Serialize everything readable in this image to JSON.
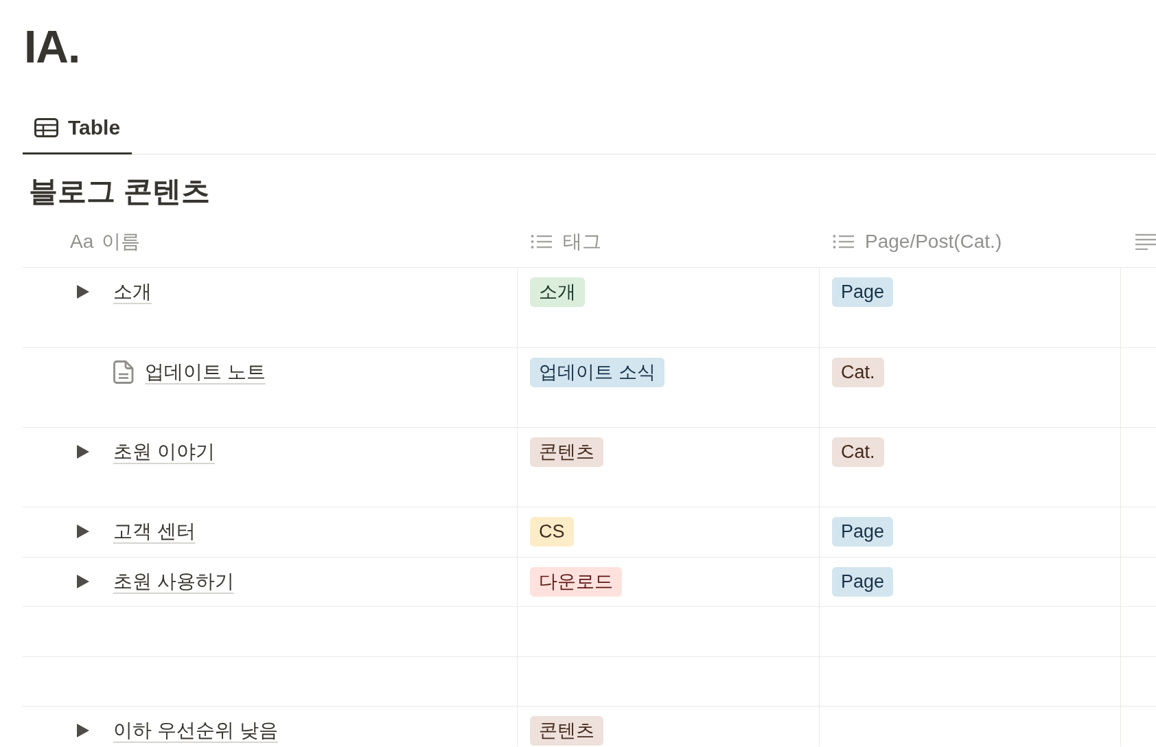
{
  "page": {
    "title": "IA."
  },
  "tabs": [
    {
      "label": "Table",
      "selected": true
    }
  ],
  "database": {
    "title": "블로그 콘텐츠",
    "columns": [
      {
        "kind": "title",
        "type_label": "Aa",
        "label": "이름"
      },
      {
        "kind": "multi_select",
        "label": "태그"
      },
      {
        "kind": "multi_select",
        "label": "Page/Post(Cat.)"
      },
      {
        "kind": "text"
      }
    ],
    "rows": [
      {
        "kind": "toggle",
        "expanded": false,
        "name": "소개",
        "tags": [
          {
            "label": "소개",
            "color": "#dbeddb"
          }
        ],
        "page_post": [
          {
            "label": "Page",
            "color": "#d3e5ef"
          }
        ]
      },
      {
        "kind": "document",
        "name": "업데이트 노트",
        "tags": [
          {
            "label": "업데이트 소식",
            "color": "#d3e5ef"
          }
        ],
        "page_post": [
          {
            "label": "Cat.",
            "color": "#eee0da"
          }
        ]
      },
      {
        "kind": "toggle",
        "expanded": false,
        "name": "초원 이야기",
        "tags": [
          {
            "label": "콘텐츠",
            "color": "#eee0da"
          }
        ],
        "page_post": [
          {
            "label": "Cat.",
            "color": "#eee0da"
          }
        ]
      },
      {
        "kind": "toggle",
        "expanded": false,
        "name": "고객 센터",
        "tags": [
          {
            "label": "CS",
            "color": "#fdecc8"
          }
        ],
        "page_post": [
          {
            "label": "Page",
            "color": "#d3e5ef"
          }
        ]
      },
      {
        "kind": "toggle",
        "expanded": false,
        "name": "초원 사용하기",
        "tags": [
          {
            "label": "다운로드",
            "color": "#ffe2dd"
          }
        ],
        "page_post": [
          {
            "label": "Page",
            "color": "#d3e5ef"
          }
        ]
      },
      {
        "kind": "blank"
      },
      {
        "kind": "blank"
      },
      {
        "kind": "toggle",
        "expanded": false,
        "name": "이하 우선순위 낮음",
        "tags": [
          {
            "label": "콘텐츠",
            "color": "#eee0da"
          }
        ]
      }
    ]
  }
}
